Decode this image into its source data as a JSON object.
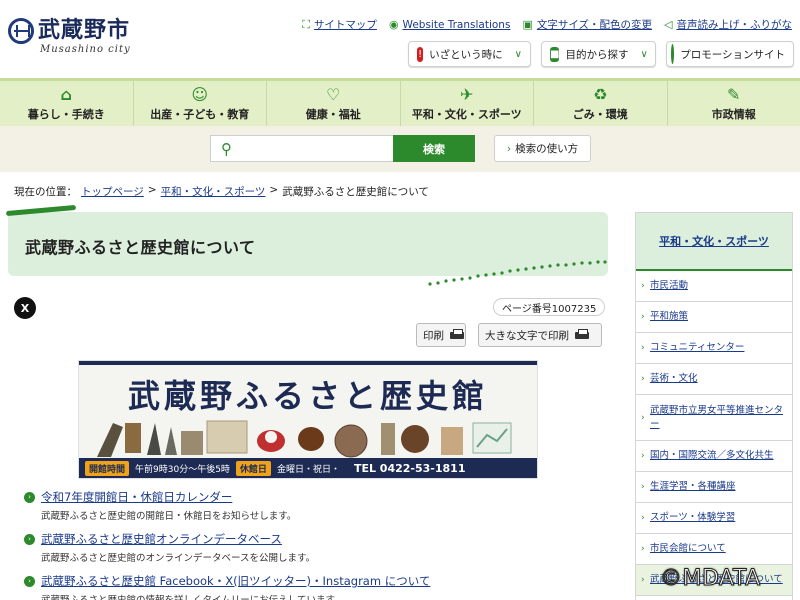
{
  "header": {
    "logo_jp": "武蔵野市",
    "logo_en": "Musashino city",
    "utility": [
      {
        "icon": "sitemap-icon",
        "label": "サイトマップ"
      },
      {
        "icon": "translate-icon",
        "label": "Website Translations"
      },
      {
        "icon": "font-size-icon",
        "label": "文字サイズ・配色の変更"
      },
      {
        "icon": "speaker-icon",
        "label": "音声読み上げ・ふりがな"
      }
    ],
    "quick": [
      {
        "icon": "alert-icon",
        "label": "いざという時に"
      },
      {
        "icon": "book-icon",
        "label": "目的から探す"
      },
      {
        "icon": "promotion-icon",
        "label": "プロモーションサイト"
      }
    ]
  },
  "gnav": [
    {
      "icon": "home-icon",
      "label": "暮らし・手続き"
    },
    {
      "icon": "child-icon",
      "label": "出産・子ども・教育"
    },
    {
      "icon": "heart-icon",
      "label": "健康・福祉"
    },
    {
      "icon": "sports-icon",
      "label": "平和・文化・スポーツ"
    },
    {
      "icon": "trash-icon",
      "label": "ごみ・環境"
    },
    {
      "icon": "document-icon",
      "label": "市政情報"
    }
  ],
  "search": {
    "placeholder": "",
    "button_label": "検索",
    "howto_label": "検索の使い方"
  },
  "breadcrumb": {
    "prefix": "現在の位置：",
    "items": [
      "トップページ",
      "平和・文化・スポーツ"
    ],
    "current": "武蔵野ふるさと歴史館について"
  },
  "page": {
    "title": "武蔵野ふるさと歴史館について",
    "page_number": "ページ番号1007235",
    "print_label": "印刷",
    "print_large_label": "大きな文字で印刷"
  },
  "hero": {
    "title": "武蔵野ふるさと歴史館",
    "hours_tag": "開館時間",
    "hours": "午前9時30分～午後5時",
    "closed_tag": "休館日",
    "closed": "金曜日・祝日・",
    "tel": "TEL 0422-53-1811"
  },
  "links": [
    {
      "title": "令和7年度開館日・休館日カレンダー",
      "desc": "武蔵野ふるさと歴史館の開館日・休館日をお知らせします。"
    },
    {
      "title": "武蔵野ふるさと歴史館オンラインデータベース",
      "desc": "武蔵野ふるさと歴史館のオンラインデータベースを公開します。"
    },
    {
      "title": "武蔵野ふるさと歴史館 Facebook・X(旧ツイッター)・Instagram について",
      "desc": "武蔵野ふるさと歴史館の情報を詳しくタイムリーにお伝えしています。"
    }
  ],
  "sidebar": {
    "heading": "平和・文化・スポーツ",
    "items": [
      "市民活動",
      "平和施策",
      "コミュニティセンター",
      "芸術・文化",
      "武蔵野市立男女平等推進センター",
      "国内・国際交流／多文化共生",
      "生涯学習・各種講座",
      "スポーツ・体験学習",
      "市民会館について",
      "武蔵野ふるさと歴史館について"
    ]
  },
  "watermark": "©MDATA",
  "colors": {
    "accent": "#2c8a2c",
    "nav_bg": "#e3efc7",
    "link": "#1a3a8a",
    "navy": "#1d2b54"
  }
}
